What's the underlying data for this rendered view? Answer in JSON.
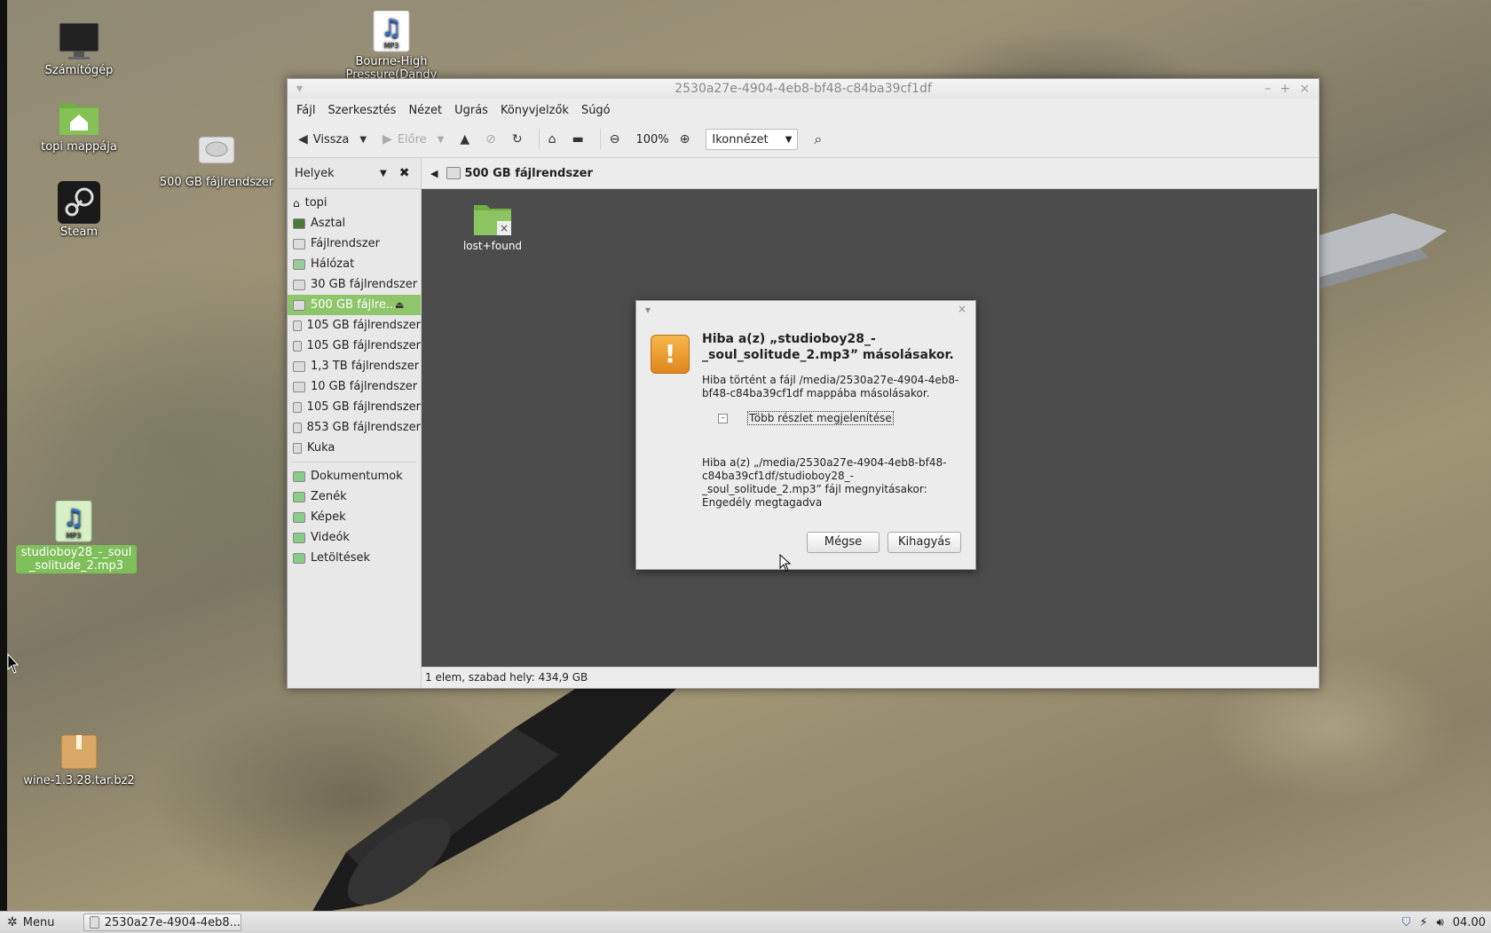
{
  "desktop": {
    "icons": [
      {
        "label": "Számítógép"
      },
      {
        "label": "topi mappája"
      },
      {
        "label": "Steam"
      },
      {
        "label": "Bourne-High Pressure(Dandy"
      },
      {
        "label": "500 GB fájlrendszer"
      },
      {
        "label": "studioboy28_-_soul_solitude_2.mp3"
      },
      {
        "label": "wine-1.3.28.tar.bz2"
      }
    ],
    "mp3_badge": "MP3"
  },
  "window": {
    "title": "2530a27e-4904-4eb8-bf48-c84ba39cf1df",
    "controls": {
      "minimize": "–",
      "maximize": "+",
      "close": "×"
    },
    "menu": [
      "Fájl",
      "Szerkesztés",
      "Nézet",
      "Ugrás",
      "Könyvjelzők",
      "Súgó"
    ],
    "toolbar": {
      "back": "Vissza",
      "forward": "Előre",
      "zoom": "100%",
      "view_mode": "Ikonnézet"
    },
    "sidebar": {
      "title": "Helyek",
      "places": [
        {
          "label": "topi"
        },
        {
          "label": "Asztal"
        },
        {
          "label": "Fájlrendszer"
        },
        {
          "label": "Hálózat"
        },
        {
          "label": "30 GB fájlrendszer"
        },
        {
          "label": "500 GB fájlre..."
        },
        {
          "label": "105 GB fájlrendszer"
        },
        {
          "label": "105 GB fájlrendszer"
        },
        {
          "label": "1,3 TB fájlrendszer"
        },
        {
          "label": "10 GB fájlrendszer"
        },
        {
          "label": "105 GB fájlrendszer"
        },
        {
          "label": "853 GB fájlrendszer"
        },
        {
          "label": "Kuka"
        }
      ],
      "bookmarks": [
        {
          "label": "Dokumentumok"
        },
        {
          "label": "Zenék"
        },
        {
          "label": "Képek"
        },
        {
          "label": "Videók"
        },
        {
          "label": "Letöltések"
        }
      ]
    },
    "location": "500 GB fájlrendszer",
    "files": [
      {
        "label": "lost+found"
      }
    ],
    "status": "1 elem, szabad hely: 434,9 GB"
  },
  "dialog": {
    "heading": "Hiba a(z) „studioboy28_-_soul_solitude_2.mp3” másolásakor.",
    "body": "Hiba történt a fájl /media/2530a27e-4904-4eb8-bf48-c84ba39cf1df mappába másolásakor.",
    "toggle_label": "Több részlet megjelenítése",
    "toggle_state": "–",
    "detail": "Hiba a(z) „/media/2530a27e-4904-4eb8-bf48-c84ba39cf1df/studioboy28_-_soul_solitude_2.mp3” fájl megnyitásakor: Engedély megtagadva",
    "cancel_label": "Mégse",
    "skip_label": "Kihagyás"
  },
  "taskbar": {
    "menu_label": "Menu",
    "task_label": "2530a27e-4904-4eb8...",
    "clock": "04.00"
  }
}
